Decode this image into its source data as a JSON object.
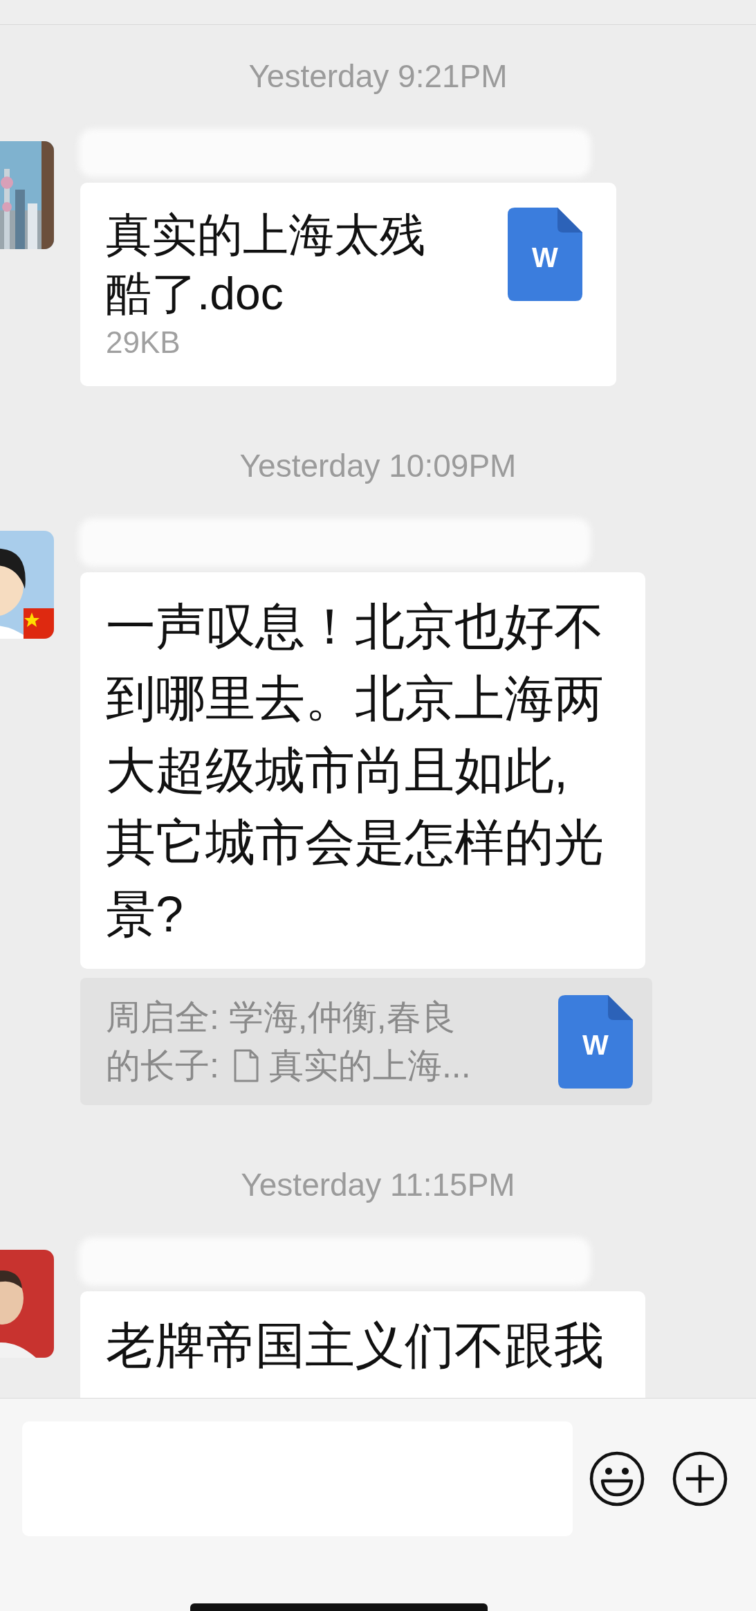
{
  "messages": [
    {
      "timestamp": "Yesterday 9:21PM",
      "avatar": {
        "kind": "city"
      },
      "kind": "file",
      "file_name": "真实的上海太残酷了.doc",
      "file_size": "29KB",
      "file_icon_label": "W"
    },
    {
      "timestamp": "Yesterday 10:09PM",
      "avatar": {
        "kind": "cartoon"
      },
      "kind": "text",
      "text": "一声叹息！北京也好不到哪里去。北京上海两大超级城市尚且如此,其它城市会是怎样的光景?",
      "quote": {
        "sender_lines": [
          "周启全: 学海,仲衡,春良",
          "的长子:"
        ],
        "file_name": "真实的上海...",
        "file_icon_label": "W"
      }
    },
    {
      "timestamp": "Yesterday 11:15PM",
      "avatar": {
        "kind": "person"
      },
      "kind": "text",
      "text": "老牌帝国主义们不跟我"
    }
  ]
}
